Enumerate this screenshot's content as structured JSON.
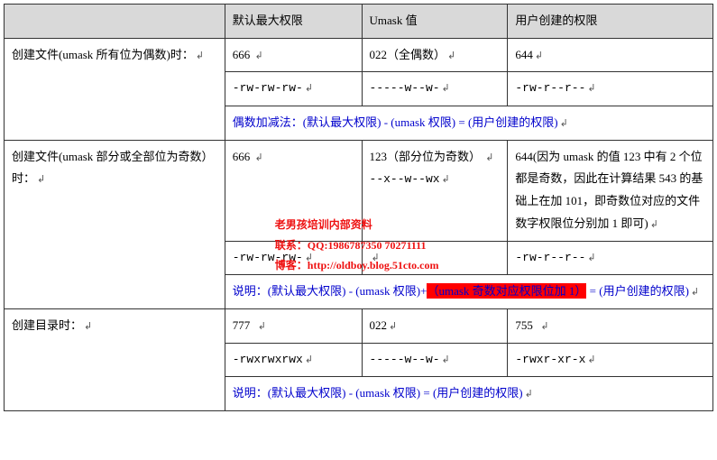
{
  "header": {
    "c1": "",
    "c2": "默认最大权限",
    "c3": "Umask 值",
    "c4": "用户创建的权限"
  },
  "row1": {
    "label": "创建文件(umask 所有位为偶数)时：",
    "maxperm": "666",
    "umask": "022（全偶数）",
    "userperm": "644",
    "maxsym": "-rw-rw-rw-",
    "umasksym": "-----w--w-",
    "usersym": "-rw-r--r--",
    "note": "偶数加减法：(默认最大权限) - (umask 权限) = (用户创建的权限)"
  },
  "row2": {
    "label": "创建文件(umask 部分或全部位为奇数）时：",
    "maxperm": "666",
    "umask1": "123（部分位为奇数）",
    "umasksym_in": "--x--w--wx",
    "userperm": "644(因为 umask 的值 123 中有 2 个位都是奇数，因此在计算结果 543 的基础上在加 101，即奇数位对应的文件数字权限位分别加 1 即可)",
    "watermark1": "老男孩培训内部资料",
    "watermark2": "联系：QQ:1986787350 70271111",
    "watermark3": "博客：http://oldboy.blog.51cto.com",
    "maxsym": "-rw-rw-rw-",
    "umasksym": "",
    "usersym": "-rw-r--r--",
    "note_pre": "说明：(默认最大权限) - (umask 权限)+",
    "note_hl": "（umask 奇数对应权限位加 1）",
    "note_post": " = (用户创建的权限)"
  },
  "row3": {
    "label": "创建目录时：",
    "maxperm": "777",
    "umask": "022",
    "userperm": "755",
    "maxsym": "-rwxrwxrwx",
    "umasksym": "-----w--w-",
    "usersym": "-rwxr-xr-x",
    "note": "说明：(默认最大权限) - (umask 权限) = (用户创建的权限)"
  }
}
